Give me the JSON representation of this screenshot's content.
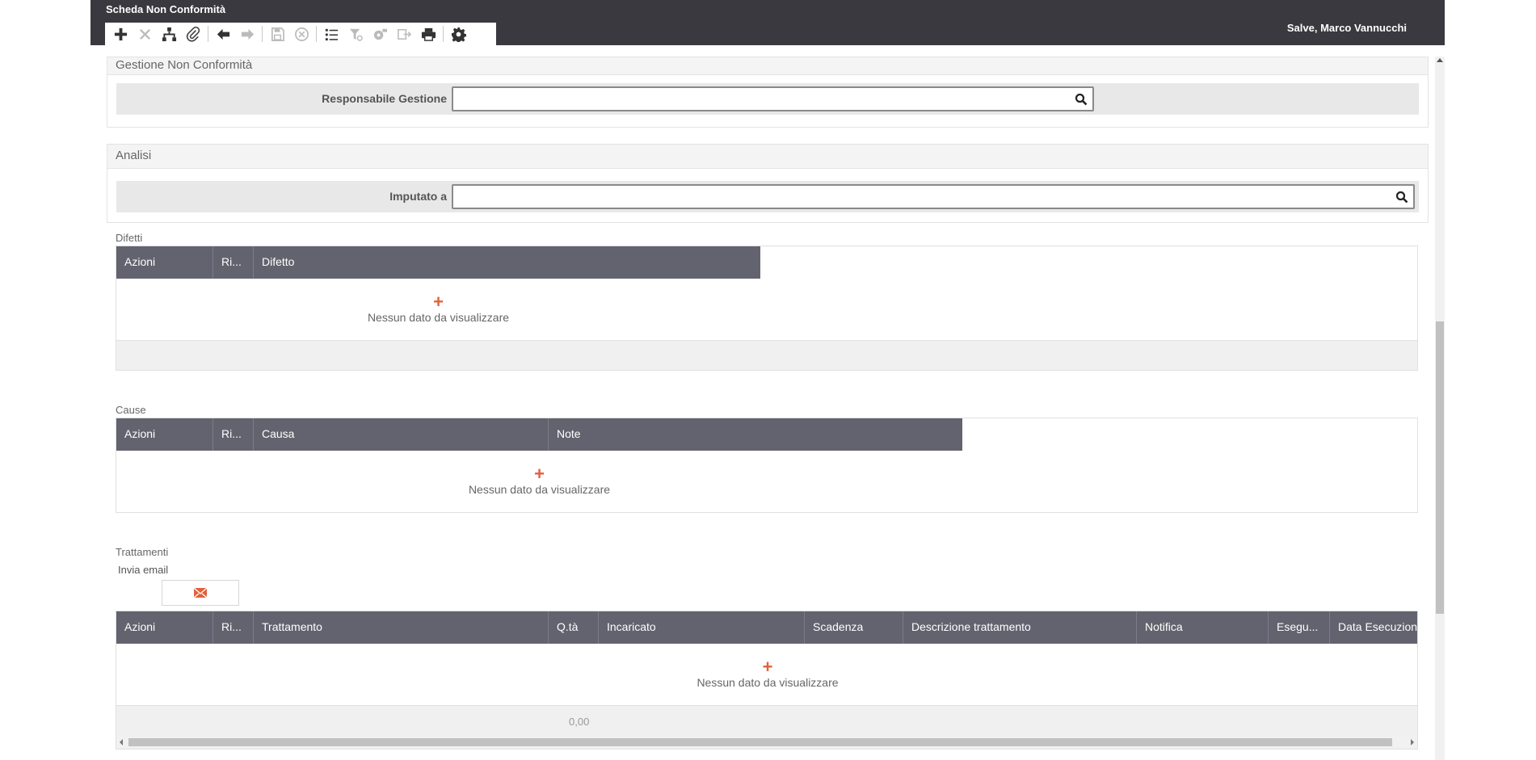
{
  "header": {
    "title": "Scheda Non Conformità",
    "greeting": "Salve, Marco Vannucchi"
  },
  "toolbar": {
    "buttons": [
      {
        "name": "add-icon",
        "enabled": true
      },
      {
        "name": "delete-icon",
        "enabled": false
      },
      {
        "name": "hierarchy-icon",
        "enabled": true
      },
      {
        "name": "attachment-icon",
        "enabled": true
      },
      {
        "name": "arrow-left-icon",
        "enabled": true
      },
      {
        "name": "arrow-right-icon",
        "enabled": false
      },
      {
        "name": "save-icon",
        "enabled": false
      },
      {
        "name": "cancel-icon",
        "enabled": false
      },
      {
        "name": "list-icon",
        "enabled": true
      },
      {
        "name": "filter-icon",
        "enabled": false
      },
      {
        "name": "settings-gear-icon",
        "enabled": false
      },
      {
        "name": "export-icon",
        "enabled": false
      },
      {
        "name": "print-icon",
        "enabled": true
      },
      {
        "name": "gear-icon",
        "enabled": true
      }
    ]
  },
  "gestione": {
    "title": "Gestione Non Conformità",
    "field_label": "Responsabile Gestione",
    "field_value": ""
  },
  "analisi": {
    "title": "Analisi",
    "field_label": "Imputato a",
    "field_value": ""
  },
  "difetti": {
    "label": "Difetti",
    "columns": [
      "Azioni",
      "Ri...",
      "Difetto"
    ],
    "empty_message": "Nessun dato da visualizzare",
    "add_symbol": "+"
  },
  "cause": {
    "label": "Cause",
    "columns": [
      "Azioni",
      "Ri...",
      "Causa",
      "Note"
    ],
    "empty_message": "Nessun dato da visualizzare",
    "add_symbol": "+"
  },
  "trattamenti": {
    "label": "Trattamenti",
    "email_label": "Invia email",
    "columns": [
      "Azioni",
      "Ri...",
      "Trattamento",
      "Q.tà",
      "Incaricato",
      "Scadenza",
      "Descrizione trattamento",
      "Notifica",
      "Esegu...",
      "Data Esecuzione"
    ],
    "empty_message": "Nessun dato da visualizzare",
    "add_symbol": "+",
    "total_qty": "0,00"
  },
  "colors": {
    "topbar": "#39393f",
    "grid_header": "#63636f",
    "accent": "#e2603a"
  }
}
